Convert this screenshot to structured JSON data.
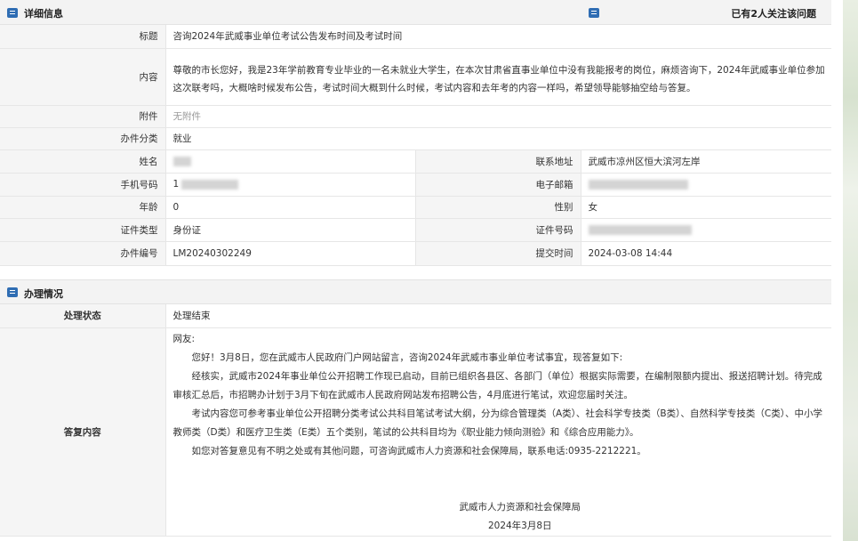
{
  "detail": {
    "section_title": "详细信息",
    "follow_text": "已有2人关注该问题",
    "fields": {
      "title_label": "标题",
      "title_value": "咨询2024年武威事业单位考试公告发布时间及考试时间",
      "content_label": "内容",
      "content_value": "尊敬的市长您好，我是23年学前教育专业毕业的一名未就业大学生，在本次甘肃省直事业单位中没有我能报考的岗位，麻烦咨询下，2024年武威事业单位参加这次联考吗，大概啥时候发布公告，考试时间大概到什么时候，考试内容和去年考的内容一样吗，希望领导能够抽空给与答复。",
      "attachment_label": "附件",
      "attachment_value": "无附件",
      "category_label": "办件分类",
      "category_value": "就业",
      "name_label": "姓名",
      "address_label": "联系地址",
      "address_value": "武威市凉州区恒大滨河左岸",
      "phone_label": "手机号码",
      "phone_value": "1",
      "email_label": "电子邮箱",
      "age_label": "年龄",
      "age_value": "0",
      "gender_label": "性别",
      "gender_value": "女",
      "idtype_label": "证件类型",
      "idtype_value": "身份证",
      "idno_label": "证件号码",
      "case_label": "办件编号",
      "case_value": "LM20240302249",
      "submit_label": "提交时间",
      "submit_value": "2024-03-08 14:44"
    }
  },
  "process": {
    "section_title": "办理情况",
    "status_label": "处理状态",
    "status_value": "处理结束",
    "reply_label": "答复内容",
    "reply": {
      "greeting": "网友:",
      "p1": "您好！3月8日，您在武威市人民政府门户网站留言，咨询2024年武威市事业单位考试事宜，现答复如下:",
      "p2": "经核实，武威市2024年事业单位公开招聘工作现已启动，目前已组织各县区、各部门（单位）根据实际需要，在编制限额内提出、报送招聘计划。待完成审核汇总后，市招聘办计划于3月下旬在武威市人民政府网站发布招聘公告，4月底进行笔试，欢迎您届时关注。",
      "p3": "考试内容您可参考事业单位公开招聘分类考试公共科目笔试考试大纲，分为综合管理类（A类）、社会科学专技类（B类）、自然科学专技类（C类）、中小学教师类（D类）和医疗卫生类（E类）五个类别，笔试的公共科目均为《职业能力倾向测验》和《综合应用能力》。",
      "p4": "如您对答复意见有不明之处或有其他问题，可咨询武威市人力资源和社会保障局，联系电话:0935-2212221。",
      "signature_org": "武威市人力资源和社会保障局",
      "signature_date": "2024年3月8日"
    }
  },
  "colors": {
    "accent": "#2f6db3",
    "label_bg": "#f5f5f5",
    "border": "#e6e6e6"
  },
  "icons": [
    "list-icon"
  ]
}
